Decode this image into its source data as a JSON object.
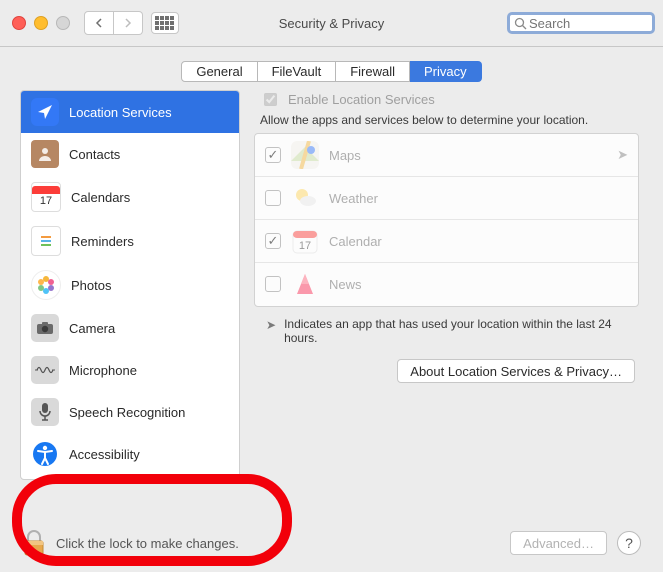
{
  "window": {
    "title": "Security & Privacy",
    "search_placeholder": "Search"
  },
  "tabs": [
    {
      "label": "General",
      "active": false
    },
    {
      "label": "FileVault",
      "active": false
    },
    {
      "label": "Firewall",
      "active": false
    },
    {
      "label": "Privacy",
      "active": true
    }
  ],
  "sidebar": {
    "items": [
      {
        "label": "Location Services",
        "icon": "location",
        "selected": true
      },
      {
        "label": "Contacts",
        "icon": "contacts",
        "selected": false
      },
      {
        "label": "Calendars",
        "icon": "calendar",
        "selected": false
      },
      {
        "label": "Reminders",
        "icon": "reminders",
        "selected": false
      },
      {
        "label": "Photos",
        "icon": "photos",
        "selected": false
      },
      {
        "label": "Camera",
        "icon": "camera",
        "selected": false
      },
      {
        "label": "Microphone",
        "icon": "microphone",
        "selected": false
      },
      {
        "label": "Speech Recognition",
        "icon": "speech",
        "selected": false
      },
      {
        "label": "Accessibility",
        "icon": "accessibility",
        "selected": false
      }
    ]
  },
  "detail": {
    "enable_label": "Enable Location Services",
    "enable_checked": true,
    "hint": "Allow the apps and services below to determine your location.",
    "apps": [
      {
        "label": "Maps",
        "checked": true,
        "recent": true,
        "icon": "maps"
      },
      {
        "label": "Weather",
        "checked": false,
        "recent": false,
        "icon": "weather"
      },
      {
        "label": "Calendar",
        "checked": true,
        "recent": false,
        "icon": "calendar"
      },
      {
        "label": "News",
        "checked": false,
        "recent": false,
        "icon": "news"
      }
    ],
    "note": "Indicates an app that has used your location within the last 24 hours.",
    "about_label": "About Location Services & Privacy…"
  },
  "footer": {
    "lock_text": "Click the lock to make changes.",
    "advanced_label": "Advanced…",
    "help": "?"
  }
}
